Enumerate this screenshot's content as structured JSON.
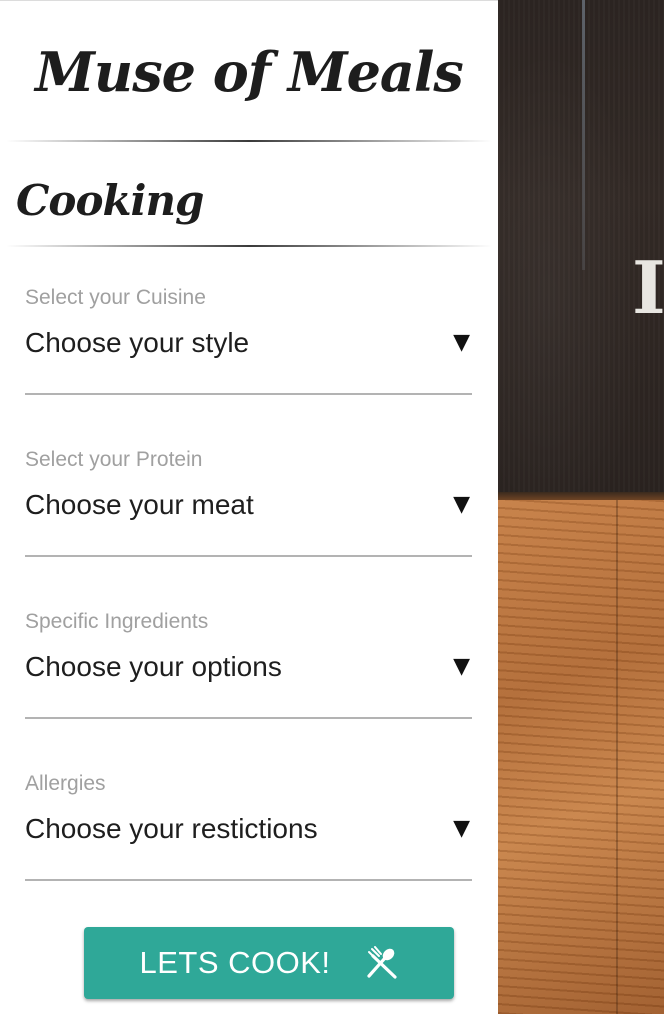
{
  "app": {
    "title": "Muse of Meals"
  },
  "sidebar": {
    "section_title": "Cooking",
    "fields": [
      {
        "label": "Select your Cuisine",
        "value": "Choose your style"
      },
      {
        "label": "Select your Protein",
        "value": "Choose your meat"
      },
      {
        "label": "Specific Ingredients",
        "value": "Choose your options"
      },
      {
        "label": "Allergies",
        "value": "Choose your restictions"
      }
    ],
    "dropdown_arrow": "▼",
    "submit": {
      "label": "LETS COOK!",
      "icon": "fork-and-spoon-icon"
    }
  },
  "hero": {
    "partial_heading_glyph": "I"
  },
  "colors": {
    "accent": "#2fa898",
    "label_gray": "#a0a0a0",
    "text_dark": "#1e1e1e",
    "chalkboard": "#2c2522",
    "wood": "#b06a36"
  }
}
